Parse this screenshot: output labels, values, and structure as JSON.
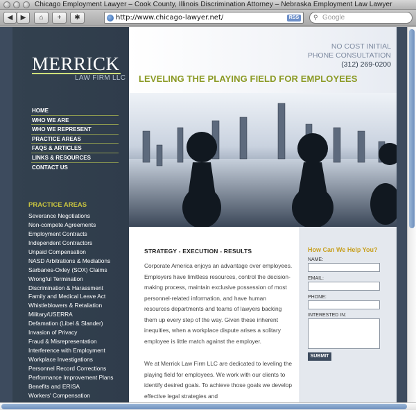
{
  "window": {
    "title": "Chicago Employment Lawyer – Cook County, Illinois Discrimination Attorney – Nebraska Employment Law Lawyer"
  },
  "toolbar": {
    "back_icon": "back-arrow-icon",
    "forward_icon": "forward-arrow-icon",
    "home_icon": "home-icon",
    "add_icon": "plus-icon",
    "bug_icon": "bug-icon",
    "url": "http://www.chicago-lawyer.net/",
    "rss_label": "RSS",
    "search_placeholder": "Google"
  },
  "brand": {
    "name": "MERRICK",
    "sub": "LAW FIRM LLC",
    "rule_color": "#cfe07a"
  },
  "nav": [
    "HOME",
    "WHO WE ARE",
    "WHO WE REPRESENT",
    "PRACTICE AREAS",
    "FAQS & ARTICLES",
    "LINKS & RESOURCES",
    "CONTACT US"
  ],
  "practice": {
    "title": "PRACTICE AREAS",
    "items": [
      "Severance Negotiations",
      "Non-compete Agreements",
      "Employment Contracts",
      "Independent Contractors",
      "Unpaid Compensation",
      "NASD Arbitrations & Mediations",
      "Sarbanes-Oxley (SOX) Claims",
      "Wrongful Termination",
      "Discrimination & Harassment",
      "Family and Medical Leave Act",
      "Whistleblowers & Retaliation",
      "Military/USERRA",
      "Defamation (Libel & Slander)",
      "Invasion of Privacy",
      "Fraud & Misrepresentation",
      "Interference with Employment",
      "Workplace Investigations",
      "Personnel Record Corrections",
      "Performance Improvement Plans",
      "Benefits and ERISA",
      "Workers' Compensation"
    ]
  },
  "header": {
    "consult_line1": "NO COST INITIAL",
    "consult_line2": "PHONE CONSULTATION",
    "phone": "(312) 269-0200",
    "tagline": "LEVELING THE PLAYING FIELD FOR EMPLOYEES"
  },
  "main": {
    "heading": "STRATEGY - EXECUTION - RESULTS",
    "para1": "Corporate America enjoys an advantage over employees. Employers have limitless resources, control the decision-making process, maintain exclusive possession of most personnel-related information, and have human resources departments and teams of lawyers backing them up every step of the way. Given these inherent inequities, when a workplace dispute arises a solitary employee is little match against the employer.",
    "para2": "We at Merrick Law Firm LLC are dedicated to leveling the playing field for employees. We work with our clients to identify desired goals. To achieve those goals we develop effective legal strategies and"
  },
  "form": {
    "title": "How Can We Help You?",
    "name_label": "NAME:",
    "email_label": "EMAIL:",
    "phone_label": "PHONE:",
    "interest_label": "INTERESTED IN:",
    "submit_label": "SUBMIT"
  },
  "colors": {
    "sidebar_bg": "#33414f",
    "accent_olive": "#8b9a25",
    "practice_title": "#c8c340",
    "help_title": "#c8a020"
  }
}
